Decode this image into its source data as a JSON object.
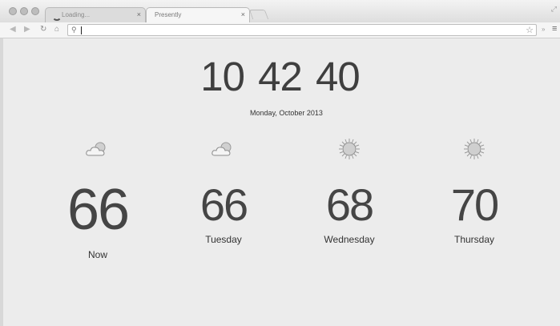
{
  "browser": {
    "tabs": [
      {
        "title": "Loading...",
        "close": "×"
      },
      {
        "title": "Presently",
        "close": "×"
      }
    ],
    "omnibox": {
      "value": "",
      "placeholder": ""
    },
    "overflow": "»"
  },
  "clock": {
    "hours": "10",
    "minutes": "42",
    "seconds": "40"
  },
  "date": "Monday, October 2013",
  "weather": [
    {
      "temp": "66",
      "label": "Now",
      "icon": "partly-cloudy-icon"
    },
    {
      "temp": "66",
      "label": "Tuesday",
      "icon": "partly-cloudy-icon"
    },
    {
      "temp": "68",
      "label": "Wednesday",
      "icon": "sun-icon"
    },
    {
      "temp": "70",
      "label": "Thursday",
      "icon": "sun-icon"
    }
  ],
  "colors": {
    "page_bg": "#ececec",
    "text": "#3f3f3f"
  }
}
